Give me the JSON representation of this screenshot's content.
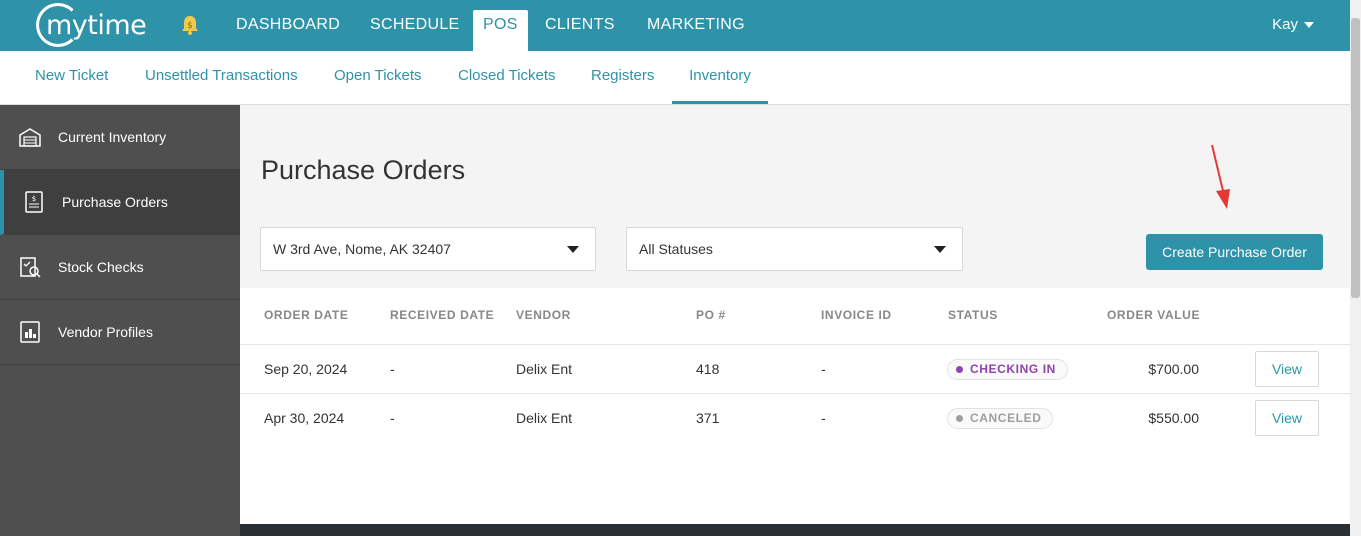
{
  "brand": {
    "name": "mytime"
  },
  "topnav": {
    "items": [
      {
        "label": "DASHBOARD"
      },
      {
        "label": "SCHEDULE"
      },
      {
        "label": "POS"
      },
      {
        "label": "CLIENTS"
      },
      {
        "label": "MARKETING"
      }
    ],
    "active": "POS",
    "user": "Kay"
  },
  "subnav": {
    "items": [
      {
        "label": "New Ticket"
      },
      {
        "label": "Unsettled Transactions"
      },
      {
        "label": "Open Tickets"
      },
      {
        "label": "Closed Tickets"
      },
      {
        "label": "Registers"
      },
      {
        "label": "Inventory"
      }
    ],
    "active": "Inventory"
  },
  "sidebar": {
    "items": [
      {
        "label": "Current Inventory",
        "icon": "warehouse-icon"
      },
      {
        "label": "Purchase Orders",
        "icon": "receipt-icon"
      },
      {
        "label": "Stock Checks",
        "icon": "clipboard-check-icon"
      },
      {
        "label": "Vendor Profiles",
        "icon": "vendor-icon"
      }
    ],
    "active": "Purchase Orders"
  },
  "main": {
    "title": "Purchase Orders",
    "location_select": "W 3rd Ave, Nome, AK 32407",
    "status_select": "All Statuses",
    "create_button": "Create Purchase Order"
  },
  "table": {
    "headers": [
      "ORDER DATE",
      "RECEIVED DATE",
      "VENDOR",
      "PO #",
      "INVOICE ID",
      "STATUS",
      "ORDER VALUE"
    ],
    "rows": [
      {
        "order_date": "Sep 20, 2024",
        "received_date": "-",
        "vendor": "Delix Ent",
        "po": "418",
        "invoice": "-",
        "status": "CHECKING IN",
        "value": "$700.00",
        "action": "View"
      },
      {
        "order_date": "Apr 30, 2024",
        "received_date": "-",
        "vendor": "Delix Ent",
        "po": "371",
        "invoice": "-",
        "status": "CANCELED",
        "value": "$550.00",
        "action": "View"
      }
    ]
  },
  "colors": {
    "brand": "#2e93a9",
    "checking_in": "#8e44ad",
    "canceled": "#9e9e9e",
    "annotation_arrow": "#e53935"
  }
}
